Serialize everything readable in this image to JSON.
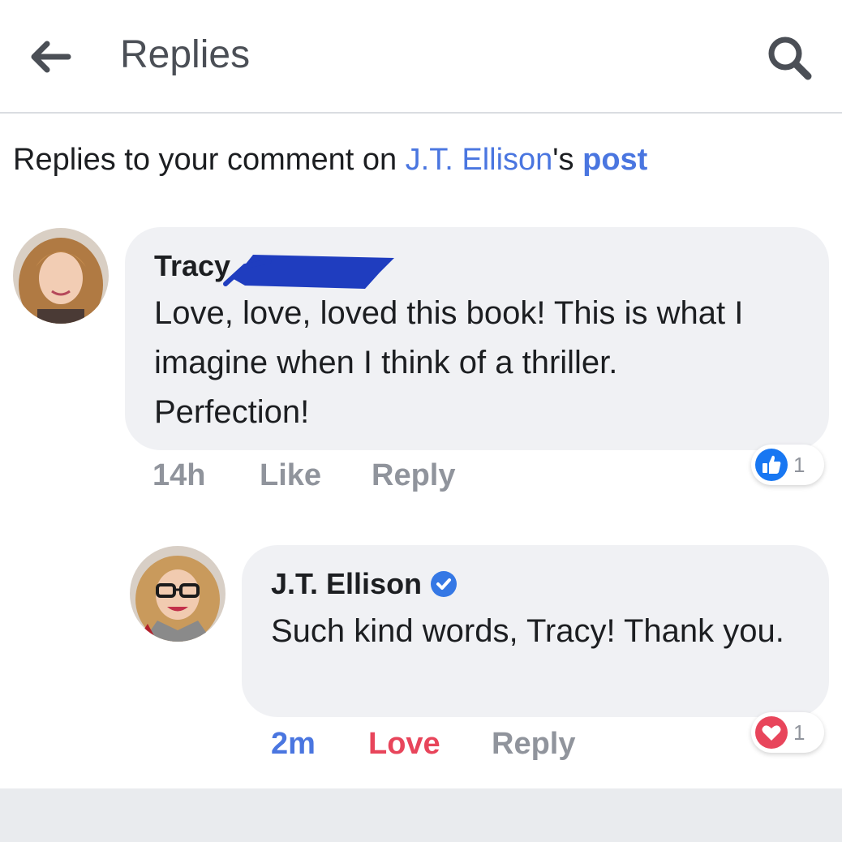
{
  "header": {
    "title": "Replies",
    "back_icon": "back-arrow-icon",
    "search_icon": "search-icon"
  },
  "context": {
    "prefix": "Replies to your comment on ",
    "author": "J.T. Ellison",
    "possessive": "'s ",
    "post": "post"
  },
  "comments": [
    {
      "author": "Tracy",
      "text": "Love, love, loved this book! This is what I imagine when I think of a thriller. Perfection!",
      "time": "14h",
      "reaction_label": "Like",
      "reply_label": "Reply",
      "reaction_icon": "like-thumb-icon",
      "reaction_count": "1"
    },
    {
      "author": "J.T. Ellison",
      "verified_icon": "verified-badge-icon",
      "text": "Such kind words, Tracy! Thank you.",
      "time": "2m",
      "reaction_label": "Love",
      "reply_label": "Reply",
      "reaction_icon": "love-heart-icon",
      "reaction_count": "1"
    }
  ],
  "colors": {
    "link": "#4a76e0",
    "love": "#e8455b",
    "muted": "#90949c",
    "bubble": "#f0f1f4",
    "redaction": "#1f3dbf"
  }
}
